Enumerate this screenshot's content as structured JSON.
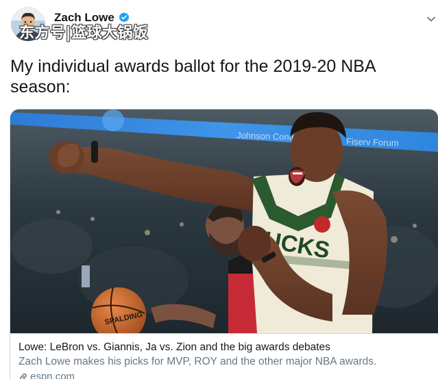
{
  "tweet": {
    "author": {
      "name": "Zach Lowe",
      "verified": true,
      "avatar_icon": "person-avatar"
    },
    "watermark": "东方号|篮球大锅饭",
    "text": "My individual awards ballot for the 2019-20 NBA season:",
    "card": {
      "image_description_icon": "basketball-photo",
      "title": "Lowe: LeBron vs. Giannis, Ja vs. Zion and the big awards debates",
      "description": "Zach Lowe makes his picks for MVP, ROY and the other major NBA awards.",
      "domain": "espn.com"
    },
    "colors": {
      "verified_blue": "#1da1f2",
      "primary_text": "#14171a",
      "secondary_text": "#657786",
      "card_border": "#ccd6dd"
    },
    "icons": {
      "verified": "verified-badge-icon",
      "menu": "chevron-down-icon",
      "link": "link-icon"
    }
  }
}
